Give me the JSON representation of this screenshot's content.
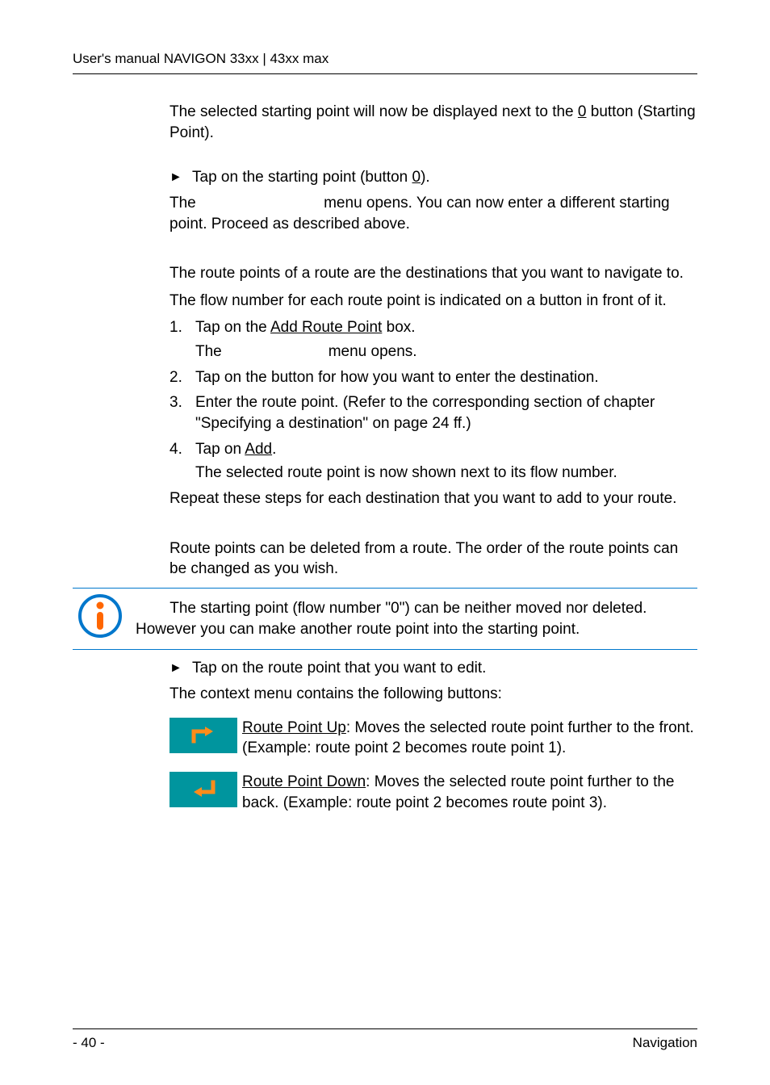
{
  "header": {
    "title": "User's manual NAVIGON 33xx | 43xx max"
  },
  "body": {
    "p1a": "The selected starting point will now be displayed next to the ",
    "p1_link": "0",
    "p1b": " button (Starting Point).",
    "bullet1a": "Tap on the starting point (button ",
    "bullet1_link": "0",
    "bullet1b": ").",
    "p2": "The                              menu opens. You can now enter a different starting point. Proceed as described above.",
    "p3": "The route points of a route are the destinations that you want to navigate to.",
    "p4": "The flow number for each route point is indicated on a button in front of it.",
    "n1a": "Tap on the ",
    "n1_link": "Add Route Point",
    "n1b": " box.",
    "n1_sub": "The                         menu opens.",
    "n2": "Tap on the button for how you want to enter the destination.",
    "n3": "Enter the route point. (Refer to the corresponding section of chapter \"Specifying a destination\" on page 24 ff.)",
    "n4a": "Tap on ",
    "n4_link": "Add",
    "n4b": ".",
    "n4_sub": "The selected route point is now shown next to its flow number.",
    "p5": "Repeat these steps for each destination that you want to add to your route.",
    "p6": "Route points can be deleted from a route. The order of the route points can be changed as you wish.",
    "note": "        The starting point (flow number \"0\") can be neither moved nor deleted. However you can make another route point into the starting point.",
    "bullet2": "Tap on the route point that you want to edit.",
    "p7": "The context menu contains the following buttons:",
    "icon1_link": "Route Point Up",
    "icon1_rest": ": Moves the selected route point further to the front. (Example: route point 2 becomes route point 1).",
    "icon2_link": "Route Point Down",
    "icon2_rest": ": Moves the selected route point further to the back. (Example: route point 2 becomes route point 3)."
  },
  "footer": {
    "page": "- 40 -",
    "section": "Navigation"
  },
  "nums": {
    "n1": "1.",
    "n2": "2.",
    "n3": "3.",
    "n4": "4."
  }
}
